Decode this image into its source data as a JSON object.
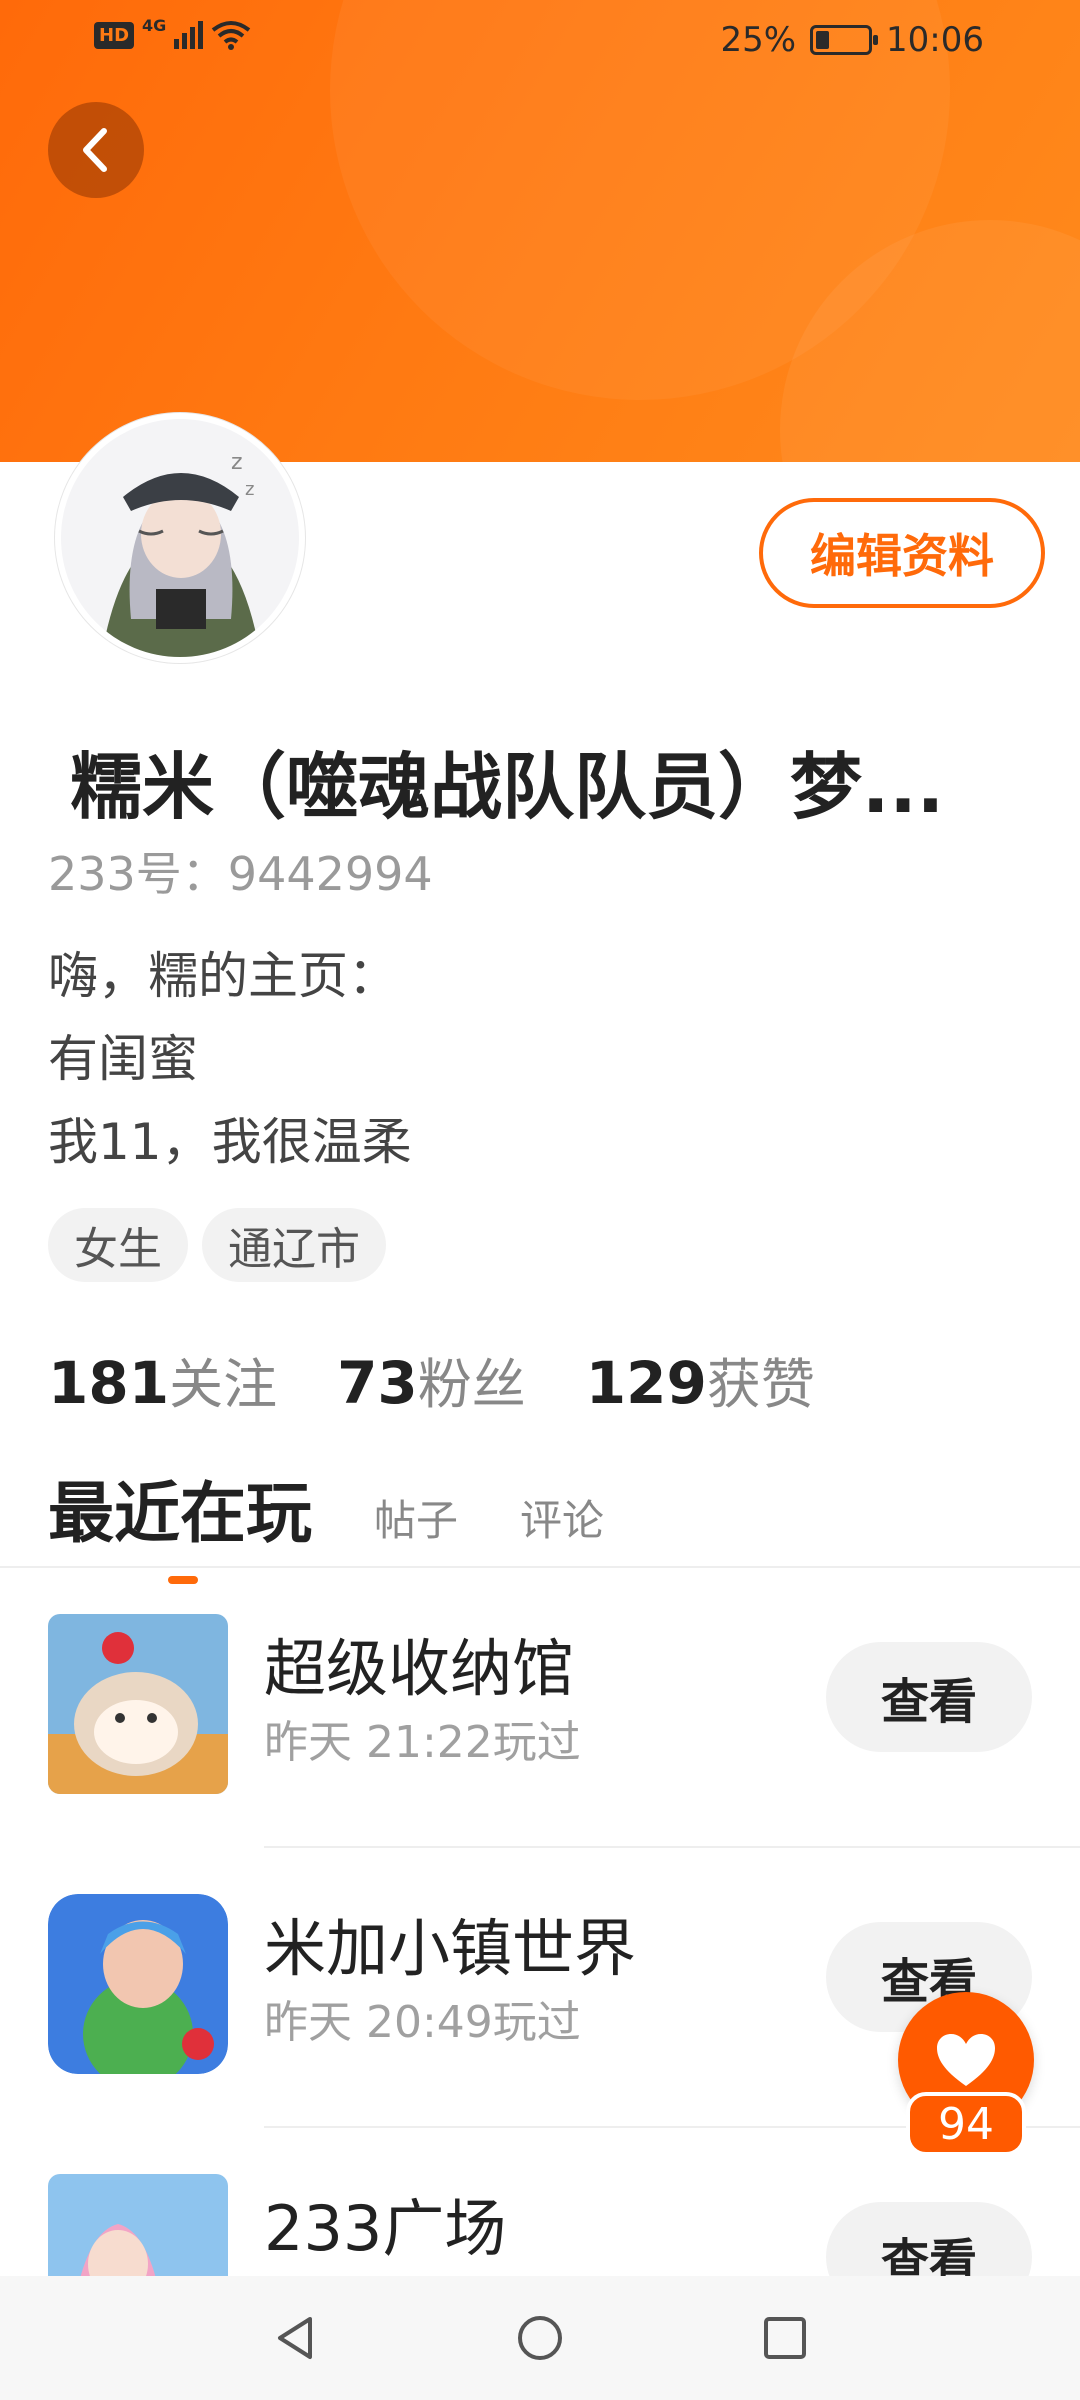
{
  "status_bar": {
    "left_badge": "HD",
    "network": "4G",
    "battery_percent": "25%",
    "battery_level": 0.25,
    "time": "10:06"
  },
  "header": {
    "back_icon": "chevron-left-icon",
    "banner_colors": [
      "#ff6a0a",
      "#ff8a1c"
    ]
  },
  "profile": {
    "edit_label": "编辑资料",
    "name": "糯米（噬魂战队队员）梦...",
    "uid": "233号：9442994",
    "bio": [
      "嗨，糯的主页：",
      "有闺蜜",
      "我11，我很温柔"
    ],
    "tags": [
      "女生",
      "通辽市"
    ],
    "stats": [
      {
        "num": "181",
        "label": "关注"
      },
      {
        "num": "73",
        "label": "粉丝"
      },
      {
        "num": "129",
        "label": "获赞"
      }
    ]
  },
  "tabs": {
    "active": "最近在玩",
    "others": [
      "帖子",
      "评论"
    ]
  },
  "games": [
    {
      "title": "超级收纳馆",
      "sub": "昨天 21:22玩过",
      "button": "查看"
    },
    {
      "title": "米加小镇世界",
      "sub": "昨天 20:49玩过",
      "button": "查看"
    },
    {
      "title": "233广场",
      "sub": "",
      "button": "查看"
    }
  ],
  "like": {
    "icon": "heart-icon",
    "count": "94"
  },
  "colors": {
    "accent": "#ff6a0a",
    "like_bg": "#ff5a00"
  }
}
